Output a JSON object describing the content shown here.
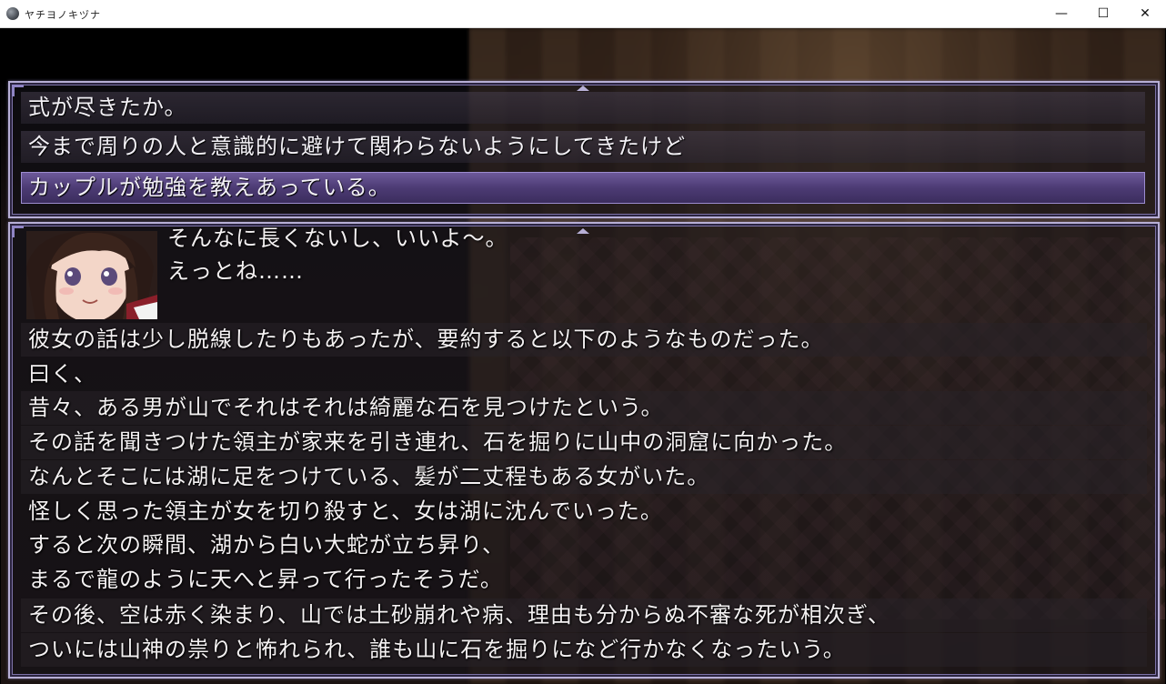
{
  "window": {
    "title": "ヤチヨノキヅナ",
    "minimize_glyph": "—",
    "maximize_glyph": "☐",
    "close_glyph": "✕"
  },
  "choices": [
    {
      "label": "式が尽きたか。",
      "selected": false
    },
    {
      "label": "今まで周りの人と意識的に避けて関わらないようにしてきたけど",
      "selected": false
    },
    {
      "label": "カップルが勉強を教えあっている。",
      "selected": true
    }
  ],
  "speech": [
    "そんなに長くないし、いいよ〜。",
    "えっとね……"
  ],
  "log_lines": [
    "彼女の話は少し脱線したりもあったが、要約すると以下のようなものだった。",
    "曰く、",
    "昔々、ある男が山でそれはそれは綺麗な石を見つけたという。",
    "その話を聞きつけた領主が家来を引き連れ、石を掘りに山中の洞窟に向かった。",
    "なんとそこには湖に足をつけている、髪が二丈程もある女がいた。",
    "怪しく思った領主が女を切り殺すと、女は湖に沈んでいった。",
    "すると次の瞬間、湖から白い大蛇が立ち昇り、",
    "まるで龍のように天へと昇って行ったそうだ。",
    "その後、空は赤く染まり、山では土砂崩れや病、理由も分からぬ不審な死が相次ぎ、",
    "ついには山神の祟りと怖れられ、誰も山に石を掘りになど行かなくなったいう。"
  ],
  "colors": {
    "frame_border": "#b7afd6",
    "selected_choice": "#5a4787",
    "text": "#f4f1f2"
  }
}
